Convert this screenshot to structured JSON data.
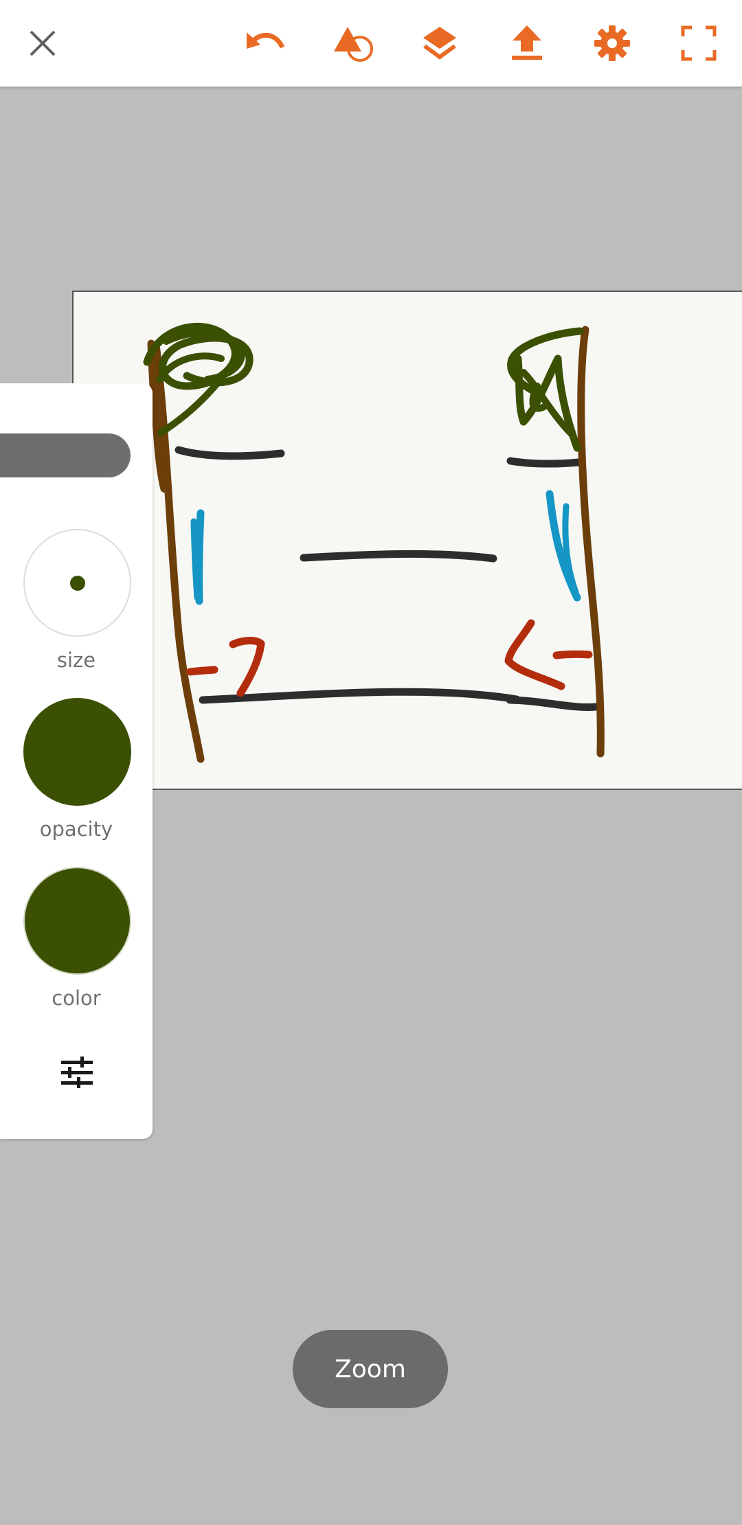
{
  "toolbar": {
    "icons": [
      "close-icon",
      "undo-icon",
      "shapes-icon",
      "layers-icon",
      "share-upload-icon",
      "settings-gear-icon",
      "fullscreen-icon"
    ],
    "accent_color": "#e86a24",
    "close_color": "#5f5f5f"
  },
  "brush_panel": {
    "size_label": "size",
    "opacity_label": "opacity",
    "color_label": "color",
    "current_color": "#3b5003",
    "settings_icon": "sliders-icon"
  },
  "canvas": {
    "background": "#f7f7f4",
    "stroke_colors": [
      "#2d2d2d",
      "#6b3e0a",
      "#3b5003",
      "#1596c4",
      "#b32d0d"
    ]
  },
  "zoom": {
    "label": "Zoom"
  }
}
